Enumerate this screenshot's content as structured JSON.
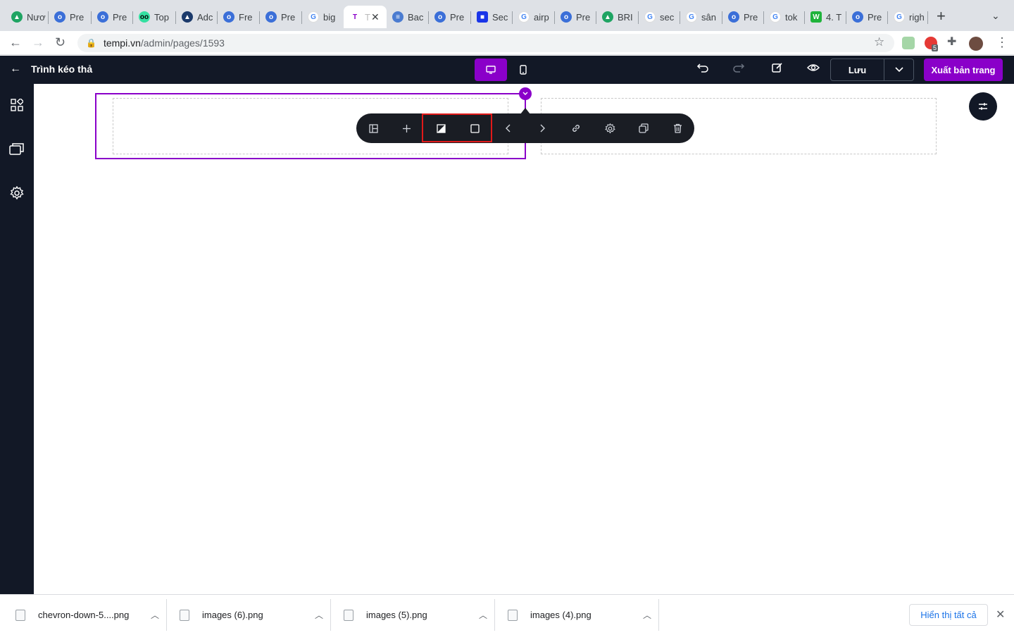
{
  "browser": {
    "tabs": [
      {
        "label": "Nươ",
        "favicon": "google-drive-icon",
        "color": "#1fa463"
      },
      {
        "label": "Pre",
        "favicon": "owl-icon",
        "color": "#3b6fd8"
      },
      {
        "label": "Pre",
        "favicon": "owl-icon",
        "color": "#3b6fd8"
      },
      {
        "label": "Top",
        "favicon": "tripadvisor-icon",
        "color": "#34e0a1"
      },
      {
        "label": "Adc",
        "favicon": "mountain-icon",
        "color": "#1b3a6b"
      },
      {
        "label": "Fre",
        "favicon": "owl-icon",
        "color": "#3b6fd8"
      },
      {
        "label": "Pre",
        "favicon": "owl-icon",
        "color": "#3b6fd8"
      },
      {
        "label": "big",
        "favicon": "google-icon",
        "color": "#4285f4"
      },
      {
        "label": "T",
        "favicon": "tempi-icon",
        "color": "#8a00c9"
      },
      {
        "label": "Bac",
        "favicon": "stack-icon",
        "color": "#4a7bd0"
      },
      {
        "label": "Pre",
        "favicon": "owl-icon",
        "color": "#3b6fd8"
      },
      {
        "label": "Sec",
        "favicon": "puzzle-icon",
        "color": "#1a35e8"
      },
      {
        "label": "airp",
        "favicon": "google-icon",
        "color": "#4285f4"
      },
      {
        "label": "Pre",
        "favicon": "owl-icon",
        "color": "#3b6fd8"
      },
      {
        "label": "BRI",
        "favicon": "google-drive-icon",
        "color": "#1fa463"
      },
      {
        "label": "sec",
        "favicon": "google-icon",
        "color": "#4285f4"
      },
      {
        "label": "sân",
        "favicon": "google-icon",
        "color": "#4285f4"
      },
      {
        "label": "Pre",
        "favicon": "owl-icon",
        "color": "#3b6fd8"
      },
      {
        "label": "tok",
        "favicon": "google-icon",
        "color": "#4285f4"
      },
      {
        "label": "4. T",
        "favicon": "w-icon",
        "color": "#1fb33b"
      },
      {
        "label": "Pre",
        "favicon": "owl-icon",
        "color": "#3b6fd8"
      },
      {
        "label": "righ",
        "favicon": "google-icon",
        "color": "#4285f4"
      }
    ],
    "active_tab": 8,
    "url_host": "tempi.vn",
    "url_path": "/admin/pages/1593",
    "extension_badge": "5"
  },
  "app": {
    "back_icon": "arrow-left-icon",
    "title": "Trình kéo thả",
    "save_label": "Lưu",
    "publish_label": "Xuất bản trang",
    "accent": "#8a00c9",
    "header_bg": "#121826"
  },
  "toolbar": {
    "buttons": [
      "layout-icon",
      "plus-icon",
      "contrast-icon",
      "square-icon",
      "chevron-left-icon",
      "chevron-right-icon",
      "link-icon",
      "gear-icon",
      "copy-icon",
      "trash-icon"
    ],
    "highlighted": [
      "contrast-icon",
      "square-icon"
    ],
    "highlight_color": "#e11919"
  },
  "downloads": {
    "items": [
      {
        "name": "chevron-down-5....png"
      },
      {
        "name": "images (6).png"
      },
      {
        "name": "images (5).png"
      },
      {
        "name": "images (4).png"
      }
    ],
    "show_all_label": "Hiển thị tất cả"
  }
}
